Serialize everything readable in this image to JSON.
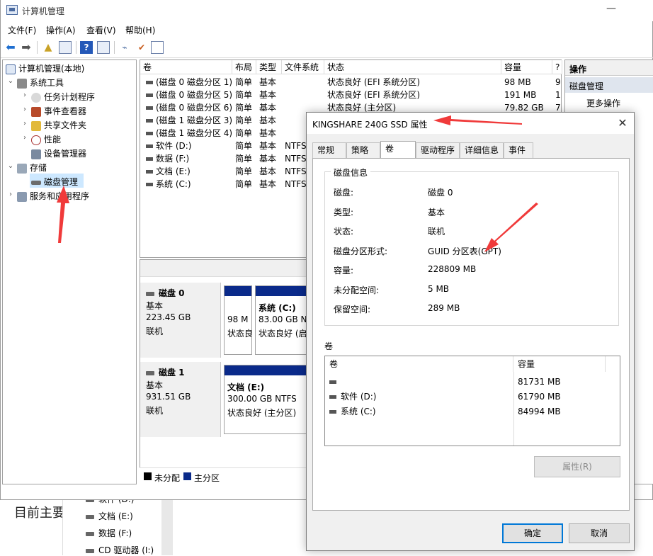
{
  "app": {
    "title": "计算机管理"
  },
  "menu": [
    "文件(F)",
    "操作(A)",
    "查看(V)",
    "帮助(H)"
  ],
  "tree": {
    "root": "计算机管理(本地)",
    "system_tools": "系统工具",
    "task_scheduler": "任务计划程序",
    "event_viewer": "事件查看器",
    "shared_folders": "共享文件夹",
    "performance": "性能",
    "device_manager": "设备管理器",
    "storage": "存储",
    "disk_management": "磁盘管理",
    "services_apps": "服务和应用程序"
  },
  "volumes": {
    "headers": [
      "卷",
      "布局",
      "类型",
      "文件系统",
      "状态",
      "容量",
      "?"
    ],
    "rows": [
      [
        "(磁盘 0 磁盘分区 1)",
        "简单",
        "基本",
        "",
        "状态良好 (EFI 系统分区)",
        "98 MB",
        "9"
      ],
      [
        "(磁盘 0 磁盘分区 5)",
        "简单",
        "基本",
        "",
        "状态良好 (EFI 系统分区)",
        "191 MB",
        "1"
      ],
      [
        "(磁盘 0 磁盘分区 6)",
        "简单",
        "基本",
        "",
        "状态良好 (主分区)",
        "79.82 GB",
        "7"
      ],
      [
        "(磁盘 1 磁盘分区 3)",
        "简单",
        "基本",
        "",
        "",
        "",
        ""
      ],
      [
        "(磁盘 1 磁盘分区 4)",
        "简单",
        "基本",
        "",
        "",
        "",
        ""
      ],
      [
        "软件 (D:)",
        "简单",
        "基本",
        "NTFS",
        "",
        "",
        ""
      ],
      [
        "数据 (F:)",
        "简单",
        "基本",
        "NTFS",
        "",
        "",
        ""
      ],
      [
        "文档 (E:)",
        "简单",
        "基本",
        "NTFS",
        "",
        "",
        ""
      ],
      [
        "系统 (C:)",
        "简单",
        "基本",
        "NTFS",
        "",
        "",
        ""
      ]
    ]
  },
  "disks": [
    {
      "name": "磁盘 0",
      "type": "基本",
      "size": "223.45 GB",
      "status": "联机",
      "p1": {
        "l1": "98 M",
        "l2": "状态良"
      },
      "p2": {
        "name": "系统 (C:)",
        "l1": "83.00 GB NT",
        "l2": "状态良好 (启"
      }
    },
    {
      "name": "磁盘 1",
      "type": "基本",
      "size": "931.51 GB",
      "status": "联机",
      "p1": {
        "name": "文档 (E:)",
        "l1": "300.00 GB NTFS",
        "l2": "状态良好 (主分区)"
      }
    }
  ],
  "legend": {
    "unallocated": "未分配",
    "primary": "主分区"
  },
  "actions": {
    "header": "操作",
    "section": "磁盘管理",
    "more": "更多操作"
  },
  "dialog": {
    "title": "KINGSHARE 240G SSD 属性",
    "tabs": [
      "常规",
      "策略",
      "卷",
      "驱动程序",
      "详细信息",
      "事件"
    ],
    "group_title": "磁盘信息",
    "info": [
      {
        "label": "磁盘:",
        "value": "磁盘 0"
      },
      {
        "label": "类型:",
        "value": "基本"
      },
      {
        "label": "状态:",
        "value": "联机"
      },
      {
        "label": "磁盘分区形式:",
        "value": "GUID 分区表(GPT)"
      },
      {
        "label": "容量:",
        "value": "228809 MB"
      },
      {
        "label": "未分配空间:",
        "value": "5 MB"
      },
      {
        "label": "保留空间:",
        "value": "289 MB"
      }
    ],
    "volumes_title": "卷",
    "vol_headers": [
      "卷",
      "容量"
    ],
    "vol_rows": [
      {
        "name": "",
        "size": "81731 MB"
      },
      {
        "name": "软件 (D:)",
        "size": "61790 MB"
      },
      {
        "name": "系统 (C:)",
        "size": "84994 MB"
      }
    ],
    "properties_btn": "属性(R)",
    "ok": "确定",
    "cancel": "取消"
  },
  "background": {
    "heading": "目前主要",
    "items": [
      "软件 (D:)",
      "文档 (E:)",
      "数据 (F:)",
      "CD 驱动器 (I:)"
    ]
  },
  "colors": {
    "primary_partition": "#0a2a8a",
    "unallocated": "#000000",
    "selection": "#cde8ff",
    "annotation_arrow": "#f03a3a",
    "accent": "#0078d7"
  }
}
